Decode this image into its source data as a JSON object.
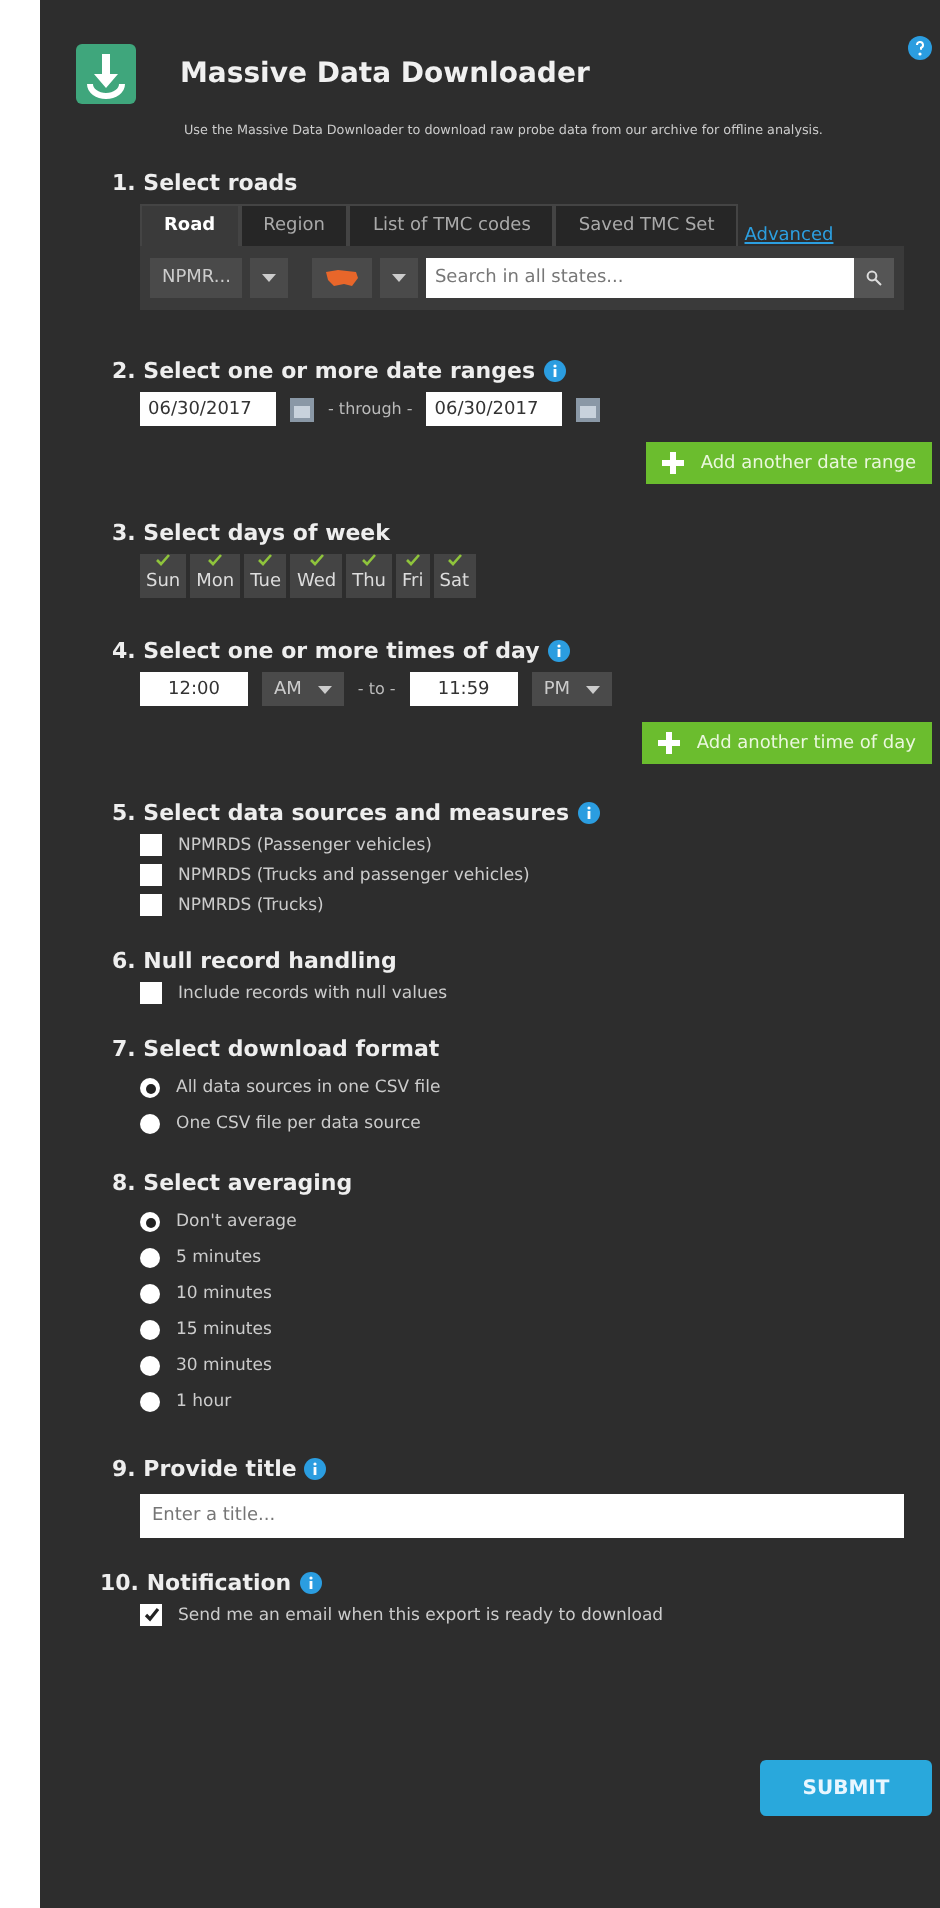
{
  "header": {
    "title": "Massive Data Downloader",
    "description": "Use the Massive Data Downloader to download raw probe data from our archive for offline analysis."
  },
  "roads": {
    "heading": "1. Select roads",
    "tabs": [
      {
        "label": "Road",
        "selected": true
      },
      {
        "label": "Region",
        "selected": false
      },
      {
        "label": "List of TMC codes",
        "selected": false
      },
      {
        "label": "Saved TMC Set",
        "selected": false
      }
    ],
    "advanced": "Advanced",
    "source": "NPMR...",
    "search": {
      "placeholder": "Search in all states..."
    }
  },
  "dates": {
    "heading": "2. Select one or more date ranges",
    "from": "06/30/2017",
    "through": "- through -",
    "to": "06/30/2017",
    "add": "Add another date range"
  },
  "days": {
    "heading": "3. Select days of week",
    "items": [
      {
        "label": "Sun",
        "checked": true
      },
      {
        "label": "Mon",
        "checked": true
      },
      {
        "label": "Tue",
        "checked": true
      },
      {
        "label": "Wed",
        "checked": true
      },
      {
        "label": "Thu",
        "checked": true
      },
      {
        "label": "Fri",
        "checked": true
      },
      {
        "label": "Sat",
        "checked": true
      }
    ]
  },
  "times": {
    "heading": "4. Select one or more times of day",
    "from": "12:00",
    "from_period": "AM",
    "sep": "- to -",
    "to": "11:59",
    "to_period": "PM",
    "add": "Add another time of day"
  },
  "sources": {
    "heading": "5. Select data sources and measures",
    "items": [
      {
        "label": "NPMRDS (Passenger vehicles)",
        "checked": false
      },
      {
        "label": "NPMRDS (Trucks and passenger vehicles)",
        "checked": false
      },
      {
        "label": "NPMRDS (Trucks)",
        "checked": false
      }
    ]
  },
  "nulls": {
    "heading": "6. Null record handling",
    "items": [
      {
        "label": "Include records with null values",
        "checked": false
      }
    ]
  },
  "format": {
    "heading": "7. Select download format",
    "items": [
      {
        "label": "All data sources in one CSV file",
        "selected": true
      },
      {
        "label": "One CSV file per data source",
        "selected": false
      }
    ]
  },
  "averaging": {
    "heading": "8. Select averaging",
    "items": [
      {
        "label": "Don't average",
        "selected": true
      },
      {
        "label": "5 minutes",
        "selected": false
      },
      {
        "label": "10 minutes",
        "selected": false
      },
      {
        "label": "15 minutes",
        "selected": false
      },
      {
        "label": "30 minutes",
        "selected": false
      },
      {
        "label": "1 hour",
        "selected": false
      }
    ]
  },
  "title": {
    "heading": "9. Provide title",
    "placeholder": "Enter a title..."
  },
  "notification": {
    "heading": "10. Notification",
    "items": [
      {
        "label": "Send me an email when this export is ready to download",
        "checked": true
      }
    ]
  },
  "submit": "SUBMIT"
}
